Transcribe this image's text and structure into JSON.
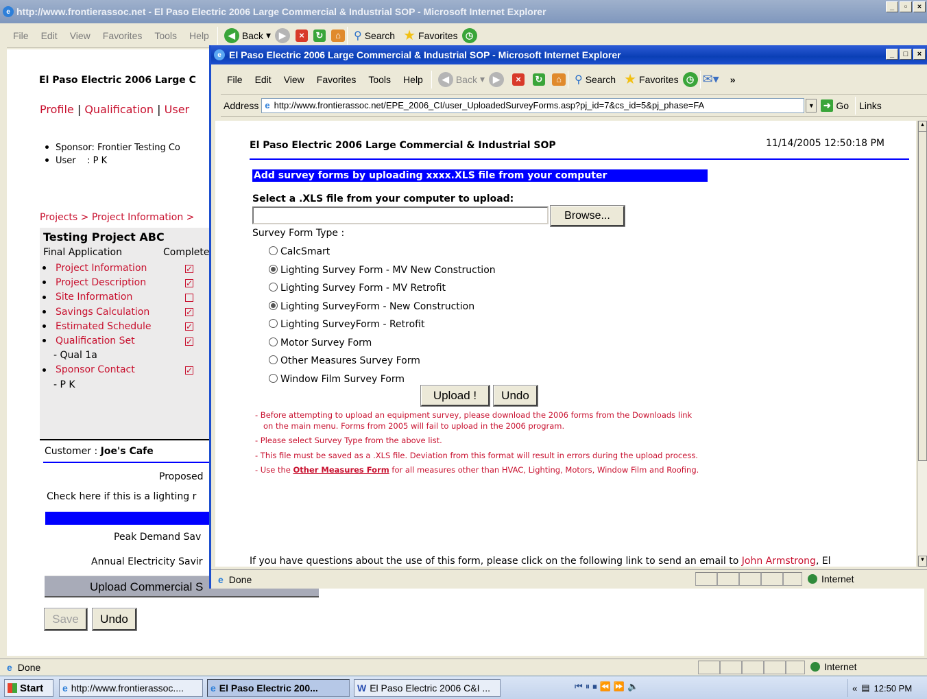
{
  "bg_window": {
    "title": "http://www.frontierassoc.net - El Paso Electric 2006 Large Commercial & Industrial SOP - Microsoft Internet Explorer",
    "menu": [
      "File",
      "Edit",
      "View",
      "Favorites",
      "Tools",
      "Help"
    ],
    "toolbar": {
      "back": "Back",
      "search": "Search",
      "favorites": "Favorites"
    },
    "page_title": "El Paso Electric 2006 Large C",
    "nav": [
      "Profile",
      "Qualification",
      "User"
    ],
    "sponsor_line": "Sponsor: Frontier Testing Co",
    "user_line": "User    : P K",
    "breadcrumb": "Projects > Project Information >",
    "project_name": "Testing Project ABC",
    "final_app_label": "Final Application",
    "complete_label": "Complete",
    "checklist": [
      {
        "label": "Project Information",
        "checked": true
      },
      {
        "label": "Project Description",
        "checked": true
      },
      {
        "label": "Site Information",
        "checked": false
      },
      {
        "label": "Savings Calculation",
        "checked": true
      },
      {
        "label": "Estimated Schedule",
        "checked": true
      },
      {
        "label": "Qualification Set",
        "checked": true
      }
    ],
    "qual_sub": "- Qual 1a",
    "sponsor_contact": "Sponsor Contact",
    "sponsor_sub": "- P K",
    "customer_label": "Customer :",
    "customer_value": "Joe's Cafe",
    "proposed": "Proposed",
    "lighting_check": "Check here if this is a lighting r",
    "peak_demand": "Peak Demand Sav",
    "annual_elec": "Annual Electricity Savir",
    "upload_commercial": "Upload Commercial S",
    "save_btn": "Save",
    "undo_btn": "Undo",
    "status": "Done",
    "zone": "Internet"
  },
  "popup": {
    "title": "El Paso Electric 2006 Large Commercial & Industrial SOP - Microsoft Internet Explorer",
    "menu": [
      "File",
      "Edit",
      "View",
      "Favorites",
      "Tools",
      "Help"
    ],
    "toolbar": {
      "back": "Back",
      "search": "Search",
      "favorites": "Favorites"
    },
    "address_label": "Address",
    "address_url": "http://www.frontierassoc.net/EPE_2006_CI/user_UploadedSurveyForms.asp?pj_id=7&cs_id=5&pj_phase=FA",
    "go": "Go",
    "links": "Links",
    "page_title": "El Paso Electric 2006 Large Commercial & Industrial SOP",
    "timestamp": "11/14/2005 12:50:18 PM",
    "banner": "Add survey forms by uploading xxxx.XLS file from your computer",
    "select_label": "Select a .XLS file from your computer to upload:",
    "file_value": "",
    "browse": "Browse...",
    "type_label": "Survey Form Type :",
    "options": [
      {
        "label": "CalcSmart",
        "filled": false
      },
      {
        "label": "Lighting Survey Form - MV New Construction",
        "filled": true
      },
      {
        "label": "Lighting Survey Form - MV Retrofit",
        "filled": false
      },
      {
        "label": "Lighting SurveyForm - New Construction",
        "filled": true
      },
      {
        "label": "Lighting SurveyForm - Retrofit",
        "filled": false
      },
      {
        "label": "Motor Survey Form",
        "filled": false
      },
      {
        "label": "Other Measures Survey Form",
        "filled": false
      },
      {
        "label": "Window Film Survey Form",
        "filled": false
      }
    ],
    "upload_btn": "Upload !",
    "undo_btn": "Undo",
    "notes": [
      "- Before attempting to upload an equipment survey, please download the 2006 forms from the Downloads link on the main menu. Forms from 2005 will fail to upload in the 2006 program.",
      "- Please select Survey Type from the above list.",
      "- This file must be saved as a .XLS file. Deviation from this format will result in errors during the upload process."
    ],
    "note4_pre": "- Use the ",
    "note4_link": "Other Measures Form",
    "note4_post": " for all measures other than HVAC, Lighting, Motors, Window Film and Roofing.",
    "footer_pre": "If you have questions about the use of this form, please click on the following link to send an email to ",
    "footer_link": "John Armstrong",
    "footer_post": ", El",
    "status": "Done",
    "zone": "Internet"
  },
  "taskbar": {
    "start": "Start",
    "items": [
      "http://www.frontierassoc....",
      "El Paso Electric 200...",
      "El Paso Electric 2006 C&I ..."
    ],
    "clock": "12:50 PM"
  },
  "colors": {
    "accent_red": "#c8102e",
    "banner_blue": "#0000ff",
    "title_blue": "#0a3fb5"
  }
}
